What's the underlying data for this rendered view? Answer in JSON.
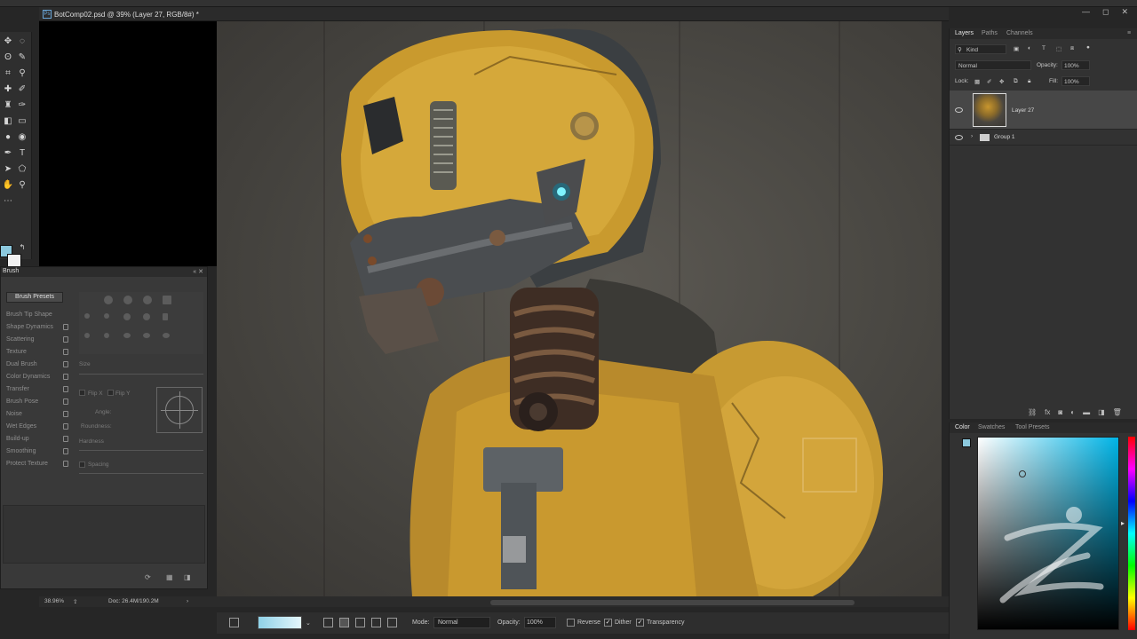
{
  "document": {
    "tab_title": "BotComp02.psd @ 39% (Layer 27, RGB/8#) *",
    "ps_badge": "Ps"
  },
  "window_controls": [
    "—",
    "◻",
    "✕"
  ],
  "brush_panel": {
    "title": "Brush",
    "presets_button": "Brush Presets",
    "items": [
      "Brush Tip Shape",
      "Shape Dynamics",
      "Scattering",
      "Texture",
      "Dual Brush",
      "Color Dynamics",
      "Transfer",
      "Brush Pose",
      "Noise",
      "Wet Edges",
      "Build-up",
      "Smoothing",
      "Protect Texture"
    ],
    "size_label": "Size",
    "flipx_label": "Flip X",
    "flipy_label": "Flip Y",
    "angle_label": "Angle:",
    "roundness_label": "Roundness:",
    "hardness_label": "Hardness",
    "spacing_label": "Spacing"
  },
  "status": {
    "zoom": "38.96%",
    "doc": "Doc: 26.4M/190.2M"
  },
  "options_bar": {
    "mode_label": "Mode:",
    "mode_value": "Normal",
    "opacity_label": "Opacity:",
    "opacity_value": "100%",
    "reverse_label": "Reverse",
    "dither_label": "Dither",
    "transparency_label": "Transparency",
    "gradient_start": "#8fd2e8",
    "gradient_end": "#e4f6fb"
  },
  "layers_panel": {
    "tabs": [
      "Layers",
      "Paths",
      "Channels"
    ],
    "kind_label": "Kind",
    "blend_mode": "Normal",
    "opacity_label": "Opacity:",
    "opacity_value": "100%",
    "lock_label": "Lock:",
    "fill_label": "Fill:",
    "fill_value": "100%",
    "layers": [
      {
        "name": "Layer 27",
        "visible": true,
        "selected": true
      },
      {
        "name": "Group 1",
        "visible": true,
        "selected": false
      }
    ]
  },
  "color_panel": {
    "tabs": [
      "Color",
      "Swatches",
      "Tool Presets"
    ],
    "foreground": "#8cc9de",
    "background": "#f2f2f2"
  },
  "icons": {
    "tools": [
      "move-icon",
      "marquee-icon",
      "lasso-icon",
      "quick-select-icon",
      "crop-icon",
      "eyedropper-icon",
      "healing-icon",
      "brush-icon",
      "clone-stamp-icon",
      "history-brush-icon",
      "eraser-icon",
      "gradient-icon",
      "blur-icon",
      "dodge-icon",
      "pen-icon",
      "type-icon",
      "path-select-icon",
      "shape-icon",
      "hand-icon",
      "zoom-icon"
    ]
  }
}
